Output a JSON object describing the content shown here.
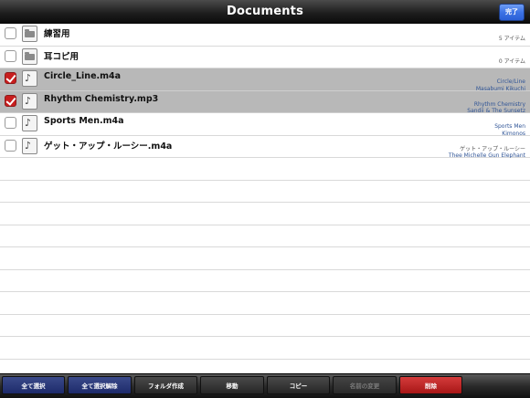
{
  "navbar": {
    "title": "Documents",
    "done_label": "完了"
  },
  "files": [
    {
      "name": "練習用",
      "kind": "folder",
      "checked": false,
      "meta1": "",
      "meta2": "5 アイテム"
    },
    {
      "name": "耳コピ用",
      "kind": "folder",
      "checked": false,
      "meta1": "",
      "meta2": "0 アイテム"
    },
    {
      "name": "Circle_Line.m4a",
      "kind": "audio",
      "checked": true,
      "meta1": "Circle/Line",
      "meta2": "Masabumi Kikuchi"
    },
    {
      "name": "Rhythm Chemistry.mp3",
      "kind": "audio",
      "checked": true,
      "meta1": "Rhythm Chemistry",
      "meta2": "Sandii & The Sunsetz"
    },
    {
      "name": "Sports Men.m4a",
      "kind": "audio",
      "checked": false,
      "meta1": "Sports Men",
      "meta2": "Kimonos"
    },
    {
      "name": "ゲット・アップ・ルーシー.m4a",
      "kind": "audio",
      "checked": false,
      "meta1": "ゲット・アップ・ルーシー",
      "meta2": "Thee Michelle Gun Elephant"
    }
  ],
  "toolbar": {
    "select_all": "全て選択",
    "deselect_all": "全て選択解除",
    "create_folder": "フォルダ作成",
    "move": "移動",
    "copy": "コピー",
    "rename": "名前の変更",
    "delete": "削除"
  },
  "colors": {
    "accent_blue": "#3d73e6",
    "delete_red": "#a71616",
    "check_red": "#c81e1e",
    "toolbar_navy": "#1d2a6a"
  }
}
